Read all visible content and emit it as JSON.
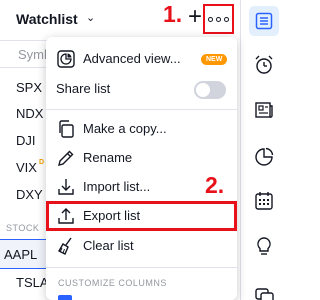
{
  "header": {
    "title": "Watchlist",
    "step1": "1.",
    "step2": "2."
  },
  "watchlist": {
    "column_header": "Symb",
    "symbols": [
      "SPX",
      "NDX",
      "DJI",
      "VIX",
      "DXY"
    ],
    "vix_badge": "D",
    "section_label": "STOCK",
    "selected_symbol": "AAPL",
    "next_symbol": "TSLA"
  },
  "menu": {
    "advanced_view": "Advanced view...",
    "new_badge": "NEW",
    "share_list": "Share list",
    "make_copy": "Make a copy...",
    "rename": "Rename",
    "import_list": "Import list...",
    "export_list": "Export list",
    "clear_list": "Clear list",
    "customize_columns": "CUSTOMIZE COLUMNS",
    "share_toggle_on": false
  },
  "colors": {
    "accent": "#2962ff",
    "highlight_red": "#e8111a",
    "badge_orange": "#ff9800"
  }
}
